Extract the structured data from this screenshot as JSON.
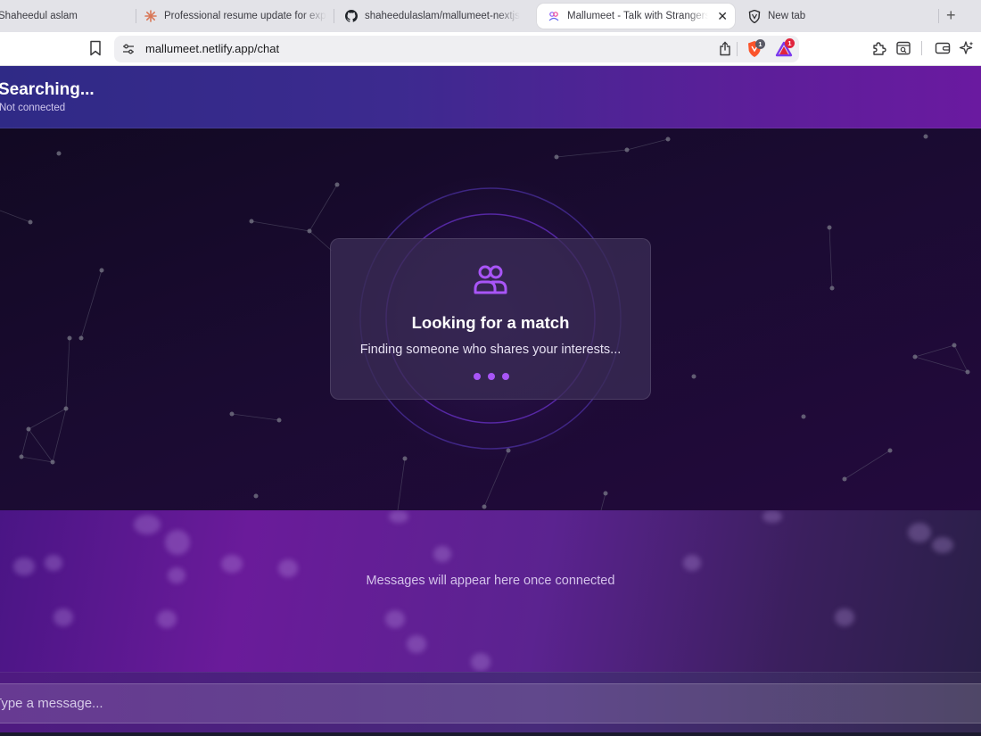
{
  "browser": {
    "tabs": [
      {
        "title": "Shaheedul aslam",
        "icon": "profile-icon",
        "active": false
      },
      {
        "title": "Professional resume update for exp",
        "icon": "claude-asterisk-icon",
        "active": false
      },
      {
        "title": "shaheedulaslam/mallumeet-nextjs",
        "icon": "github-icon",
        "active": false
      },
      {
        "title": "Mallumeet - Talk with Strangers",
        "icon": "mallumeet-favicon",
        "active": true
      },
      {
        "title": "New tab",
        "icon": "brave-icon",
        "active": false
      }
    ],
    "close_glyph": "✕",
    "new_tab_glyph": "+",
    "url": "mallumeet.netlify.app/chat",
    "shield_badge": "1",
    "rewards_badge": "1",
    "colors": {
      "brave_orange": "#fb542b",
      "rewards_red": "#e0243d"
    }
  },
  "app": {
    "header": {
      "status": "Searching...",
      "subtitle": "Not connected"
    },
    "match": {
      "title": "Looking for a match",
      "subtitle": "Finding someone who shares your interests...",
      "icon": "users-icon",
      "accent": "#a855f7"
    },
    "messages": {
      "empty_text": "Messages will appear here once connected"
    },
    "input": {
      "placeholder": "Type a message..."
    }
  }
}
